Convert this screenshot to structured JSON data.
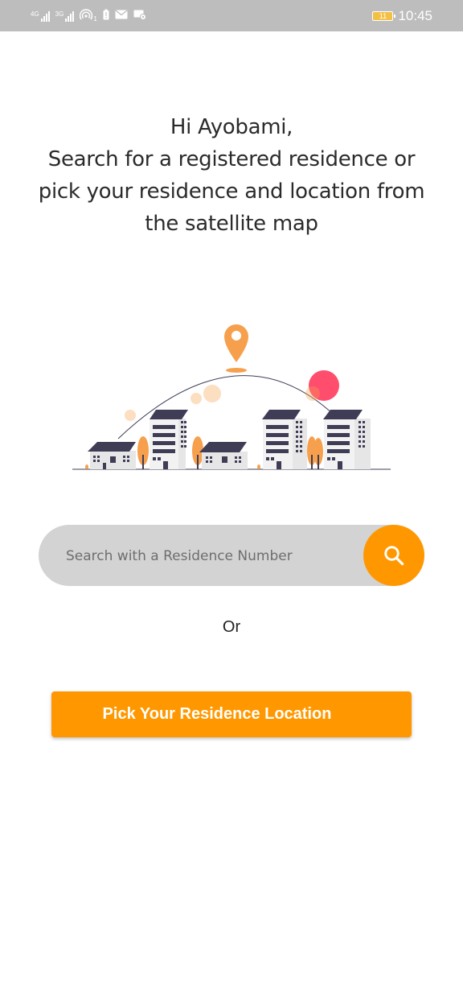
{
  "status_bar": {
    "network_1": "4G",
    "network_2": "3G",
    "hotspot_count": "1",
    "battery": "11",
    "time": "10:45"
  },
  "greeting": {
    "line1": "Hi Ayobami,",
    "line2": "Search for a registered residence or",
    "line3": "pick your residence and location from",
    "line4": "the satellite map"
  },
  "illustration": {
    "name": "residence-map-illustration",
    "colors": {
      "pin": "#f6a04d",
      "building_roof": "#3f3d56",
      "building_wall": "#e6e6e6",
      "tree": "#f6a04d",
      "sun": "#ff4d6d"
    }
  },
  "search": {
    "placeholder": "Search with a Residence Number",
    "button_icon": "search-icon"
  },
  "or_label": "Or",
  "pick_button": {
    "label": "Pick Your Residence Location"
  },
  "colors": {
    "accent": "#ff9800",
    "search_bg": "#d3d3d3",
    "status_bar_bg": "#bdbdbd"
  }
}
